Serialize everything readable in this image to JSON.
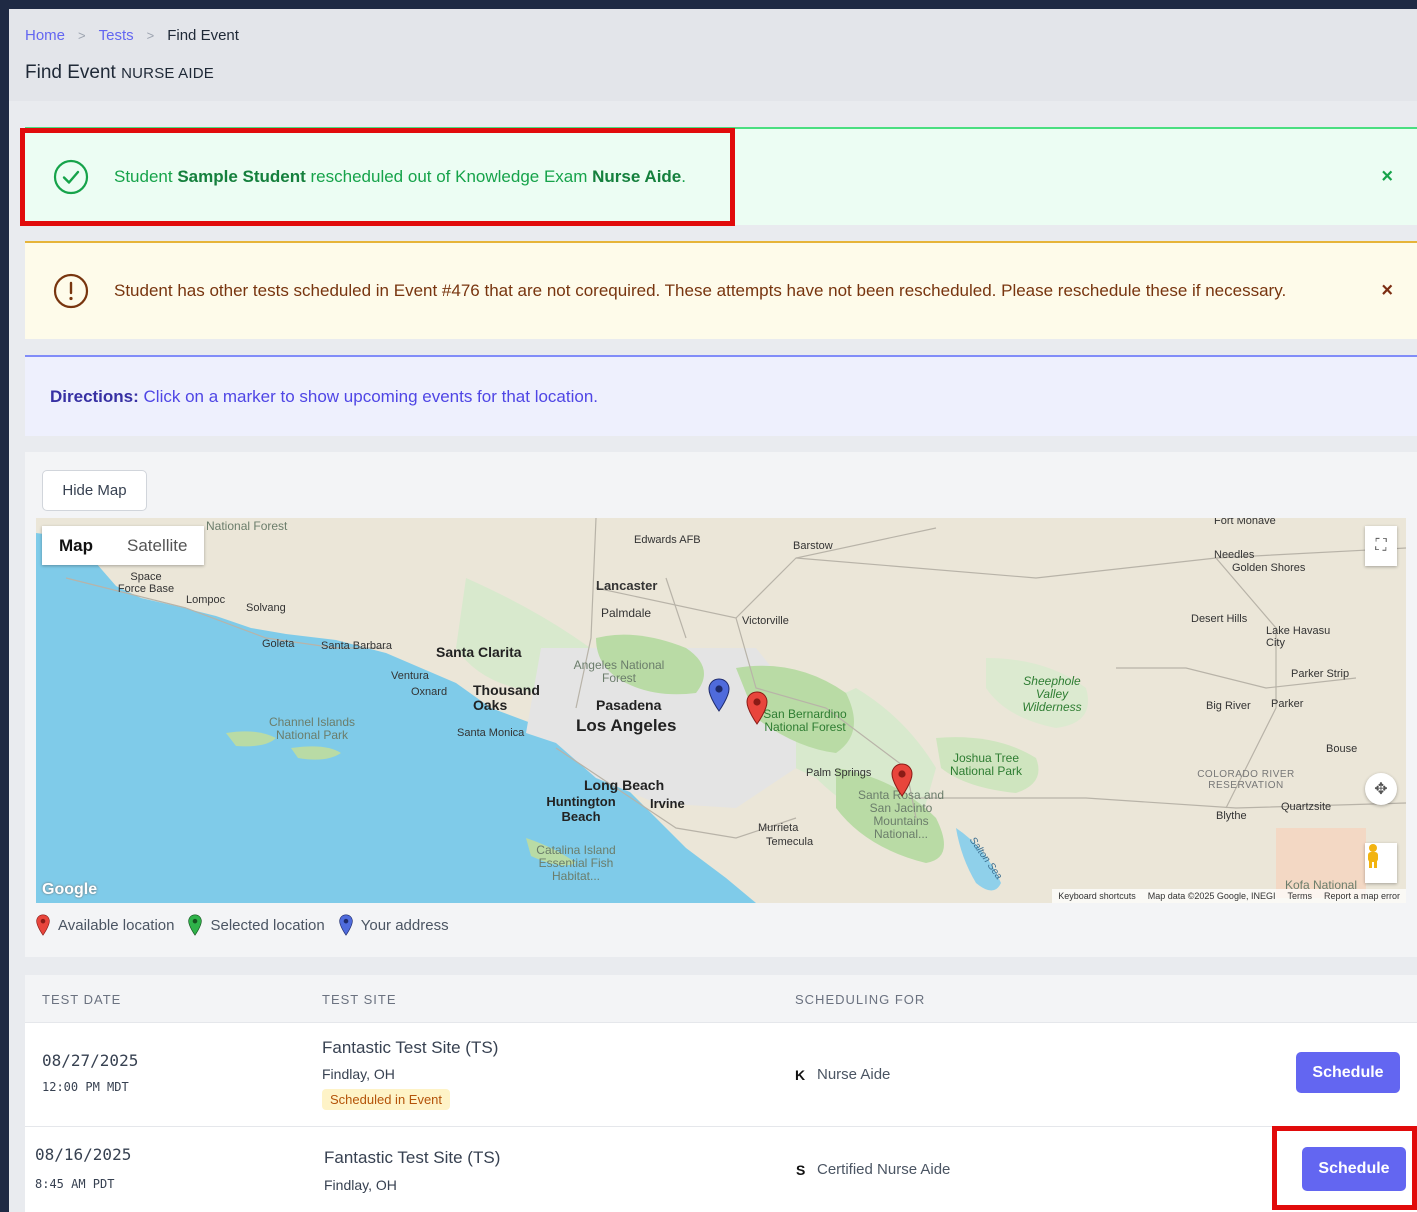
{
  "breadcrumb": {
    "home": "Home",
    "tests": "Tests",
    "current": "Find Event"
  },
  "page": {
    "title": "Find Event",
    "subtitle": "Nurse Aide"
  },
  "alerts": {
    "success": {
      "pre": "Student ",
      "student": "Sample Student",
      "mid": " rescheduled out of Knowledge Exam ",
      "exam": "Nurse Aide",
      "post": ".",
      "close": "×"
    },
    "warning": {
      "text": "Student has other tests scheduled in Event #476 that are not corequired. These attempts have not been rescheduled. Please reschedule these if necessary.",
      "close": "×"
    },
    "info": {
      "label": "Directions:",
      "text": " Click on a marker to show upcoming events for that location."
    }
  },
  "map": {
    "hide_label": "Hide Map",
    "type_map": "Map",
    "type_satellite": "Satellite",
    "google": "Google",
    "attribution": {
      "shortcuts": "Keyboard shortcuts",
      "data": "Map data ©2025 Google, INEGI",
      "terms": "Terms",
      "report": "Report a map error"
    },
    "places": {
      "national_forest": "National Forest",
      "edwards": "Edwards AFB",
      "barstow": "Barstow",
      "fort_mohave": "Fort Mohave",
      "needles": "Needles",
      "golden_shores": "Golden Shores",
      "lancaster": "Lancaster",
      "palmdale": "Palmdale",
      "victorville": "Victorville",
      "desert_hills": "Desert Hills",
      "lake_havasu": "Lake Havasu City",
      "lompoc": "Lompoc",
      "solvang": "Solvang",
      "space_force": "Space Force Base",
      "goleta": "Goleta",
      "santa_barbara": "Santa Barbara",
      "santa_clarita": "Santa Clarita",
      "ventura": "Ventura",
      "oxnard": "Oxnard",
      "thousand_oaks": "Thousand Oaks",
      "angeles_nf": "Angeles National Forest",
      "pasadena": "Pasadena",
      "los_angeles": "Los Angeles",
      "santa_monica": "Santa Monica",
      "channel_islands": "Channel Islands National Park",
      "sheephole": "Sheephole Valley Wilderness",
      "parker_strip": "Parker Strip",
      "big_river": "Big River",
      "parker": "Parker",
      "san_bernardino": "San Bernardino National Forest",
      "long_beach": "Long Beach",
      "huntington_beach": "Huntington Beach",
      "irvine": "Irvine",
      "palm_springs": "Palm Springs",
      "joshua_tree": "Joshua Tree National Park",
      "colorado_river": "COLORADO RIVER RESERVATION",
      "bouse": "Bouse",
      "quartzsite": "Quartzsite",
      "blythe": "Blythe",
      "santa_rosa": "Santa Rosa and San Jacinto Mountains National...",
      "murrieta": "Murrieta",
      "temecula": "Temecula",
      "catalina": "Catalina Island Essential Fish Habitat...",
      "salton_sea": "Salton Sea",
      "kofa": "Kofa National"
    }
  },
  "legend": {
    "available": "Available location",
    "selected": "Selected location",
    "address": "Your address"
  },
  "table": {
    "headers": {
      "date": "TEST DATE",
      "site": "TEST SITE",
      "for": "SCHEDULING FOR"
    },
    "rows": [
      {
        "date": "08/27/2025",
        "time": "12:00 PM MDT",
        "site": "Fantastic Test Site (TS)",
        "city": "Findlay, OH",
        "badge": "Scheduled in Event",
        "code": "K",
        "exam": "Nurse Aide",
        "button": "Schedule"
      },
      {
        "date": "08/16/2025",
        "time": "8:45 AM PDT",
        "site": "Fantastic Test Site (TS)",
        "city": "Findlay, OH",
        "code": "S",
        "exam": "Certified Nurse Aide",
        "button": "Schedule"
      }
    ]
  },
  "colors": {
    "accent": "#6366f1",
    "success": "#16a34a",
    "warning": "#e6b43a",
    "highlight": "#e10b0b"
  }
}
